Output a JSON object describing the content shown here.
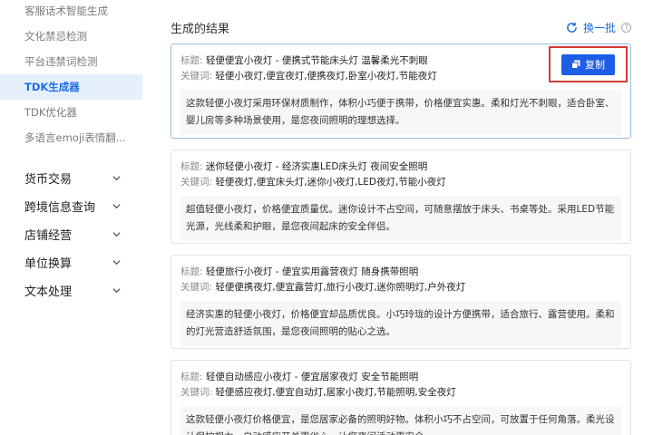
{
  "sidebar": {
    "sub_items": [
      {
        "label": "客服话术智能生成"
      },
      {
        "label": "文化禁忌检测"
      },
      {
        "label": "平台违禁词检测"
      },
      {
        "label": "TDK生成器"
      },
      {
        "label": "TDK优化器"
      },
      {
        "label": "多语言emoji表情翻..."
      }
    ],
    "active_sub": "TDK生成器",
    "menu_items": [
      {
        "label": "货币交易"
      },
      {
        "label": "跨境信息查询"
      },
      {
        "label": "店铺经营"
      },
      {
        "label": "单位换算"
      },
      {
        "label": "文本处理"
      }
    ]
  },
  "main": {
    "title": "生成的结果",
    "refresh_label": "换一批",
    "help_symbol": "?",
    "title_prefix": "标题:",
    "keyword_prefix": "关键词:",
    "copy_label": "复制",
    "results": [
      {
        "title": "轻便便宜小夜灯 - 便携式节能床头灯 温馨柔光不刺眼",
        "keywords": "轻便小夜灯,便宜夜灯,便携夜灯,卧室小夜灯,节能夜灯",
        "description": "这款轻便小夜灯采用环保材质制作，体积小巧便于携带，价格便宜实惠。柔和灯光不刺眼，适合卧室、婴儿房等多种场景使用，是您夜间照明的理想选择。"
      },
      {
        "title": "迷你轻便小夜灯 - 经济实惠LED床头灯 夜间安全照明",
        "keywords": "轻便夜灯,便宜床头灯,迷你小夜灯,LED夜灯,节能小夜灯",
        "description": "超值轻便小夜灯，价格便宜质量优。迷你设计不占空间，可随意摆放于床头、书桌等处。采用LED节能光源，光线柔和护眼，是您夜间起床的安全伴侣。"
      },
      {
        "title": "轻便旅行小夜灯 - 便宜实用露营夜灯 随身携带照明",
        "keywords": "轻便便携夜灯,便宜露营灯,旅行小夜灯,迷你照明灯,户外夜灯",
        "description": "经济实惠的轻便小夜灯，价格便宜却品质优良。小巧玲珑的设计方便携带，适合旅行、露营使用。柔和的灯光营造舒适氛围，是您夜间照明的贴心之选。"
      },
      {
        "title": "轻便自动感应小夜灯 - 便宜居家夜灯 安全节能照明",
        "keywords": "轻便感应夜灯,便宜自动灯,居家小夜灯,节能照明,安全夜灯",
        "description": "这款轻便小夜灯价格便宜，是您居家必备的照明好物。体积小巧不占空间，可放置于任何角落。柔光设计保护视力，自动感应开关更省心，让您夜间活动更安全。"
      }
    ]
  },
  "colors": {
    "accent": "#1e6de6",
    "button": "#1e5ee6",
    "highlight_box": "#d23a3a",
    "active_bg": "#e6f0fd"
  }
}
